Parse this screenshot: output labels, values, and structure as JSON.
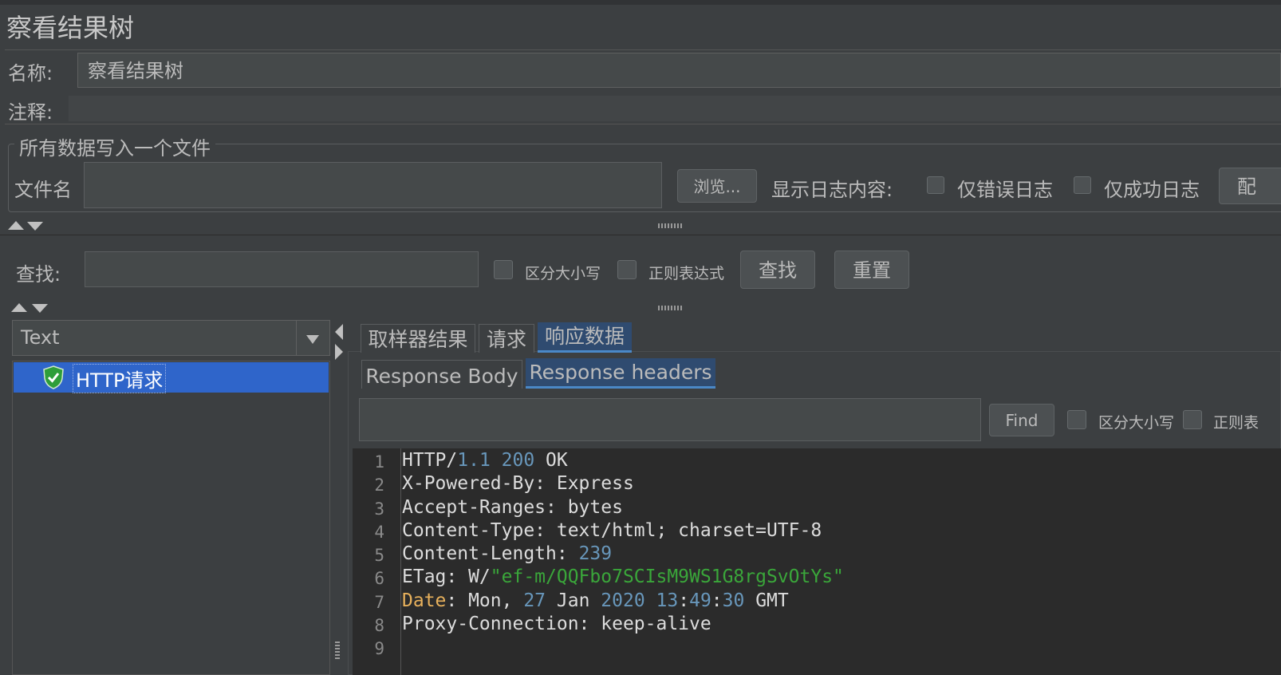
{
  "panel_title": "察看结果树",
  "name": {
    "label": "名称:",
    "value": "察看结果树"
  },
  "comment": {
    "label": "注释:"
  },
  "file_group": {
    "title": "所有数据写入一个文件",
    "filename_label": "文件名",
    "browse_label": "浏览...",
    "log_label": "显示日志内容:",
    "errors_only": "仅错误日志",
    "success_only": "仅成功日志",
    "config_label": "配"
  },
  "search": {
    "label": "查找:",
    "case_sensitive": "区分大小写",
    "regex": "正则表达式",
    "find_label": "查找",
    "reset_label": "重置"
  },
  "renderer": {
    "selected": "Text"
  },
  "tree": {
    "items": [
      {
        "label": "HTTP请求",
        "status": "success"
      }
    ]
  },
  "result_tabs": [
    "取样器结果",
    "请求",
    "响应数据"
  ],
  "response_tabs": [
    "Response Body",
    "Response headers"
  ],
  "inner_search": {
    "find_label": "Find",
    "case_sensitive": "区分大小写",
    "regex_partial": "正则表"
  },
  "colors": {
    "accent": "#2f65ca",
    "background": "#3c3f41",
    "editor_bg": "#2b2b2b"
  },
  "headers": {
    "line_numbers": [
      "1",
      "2",
      "3",
      "4",
      "5",
      "6",
      "7",
      "8",
      "9"
    ],
    "lines": [
      "HTTP/1.1 200 OK",
      "X-Powered-By: Express",
      "Accept-Ranges: bytes",
      "Content-Type: text/html; charset=UTF-8",
      "Content-Length: 239",
      "ETag: W/\"ef-m/QQFbo7SCIsM9WS1G8rgSvOtYs\"",
      "Date: Mon, 27 Jan 2020 13:49:30 GMT",
      "Proxy-Connection: keep-alive",
      ""
    ]
  }
}
